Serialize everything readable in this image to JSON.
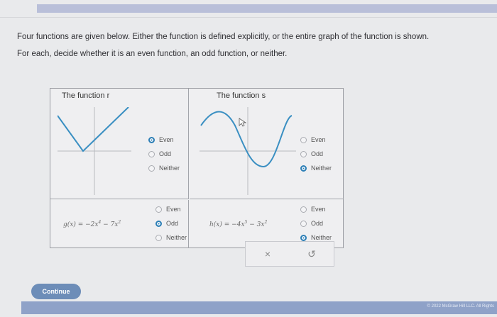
{
  "instructions": {
    "line1": "Four functions are given below. Either the function is defined explicitly, or the entire graph of the function is shown.",
    "line2": "For each, decide whether it is an even function, an odd function, or neither."
  },
  "panels": {
    "top_left": {
      "title": "The function r",
      "options": [
        {
          "label": "Even",
          "selected": true
        },
        {
          "label": "Odd",
          "selected": false
        },
        {
          "label": "Neither",
          "selected": false
        }
      ]
    },
    "top_right": {
      "title": "The function s",
      "options": [
        {
          "label": "Even",
          "selected": false
        },
        {
          "label": "Odd",
          "selected": false
        },
        {
          "label": "Neither",
          "selected": true
        }
      ]
    },
    "bottom_left": {
      "formula_name": "g(x)",
      "formula_rhs": "= −2x",
      "exp1": "4",
      "mid": " − 7x",
      "exp2": "2",
      "options": [
        {
          "label": "Even",
          "selected": false
        },
        {
          "label": "Odd",
          "selected": true
        },
        {
          "label": "Neither",
          "selected": false
        }
      ]
    },
    "bottom_right": {
      "formula_name": "h(x)",
      "formula_rhs": "= −4x",
      "exp1": "5",
      "mid": " − 3x",
      "exp2": "2",
      "options": [
        {
          "label": "Even",
          "selected": false
        },
        {
          "label": "Odd",
          "selected": false
        },
        {
          "label": "Neither",
          "selected": true
        }
      ]
    }
  },
  "actions": {
    "clear": "×",
    "undo": "↺"
  },
  "continue_label": "Continue",
  "copyright": "© 2022 McGraw Hill LLC. All Rights",
  "colors": {
    "accent": "#2d7fb6",
    "graph": "#3a8fc2",
    "continue": "#6d8db8"
  }
}
